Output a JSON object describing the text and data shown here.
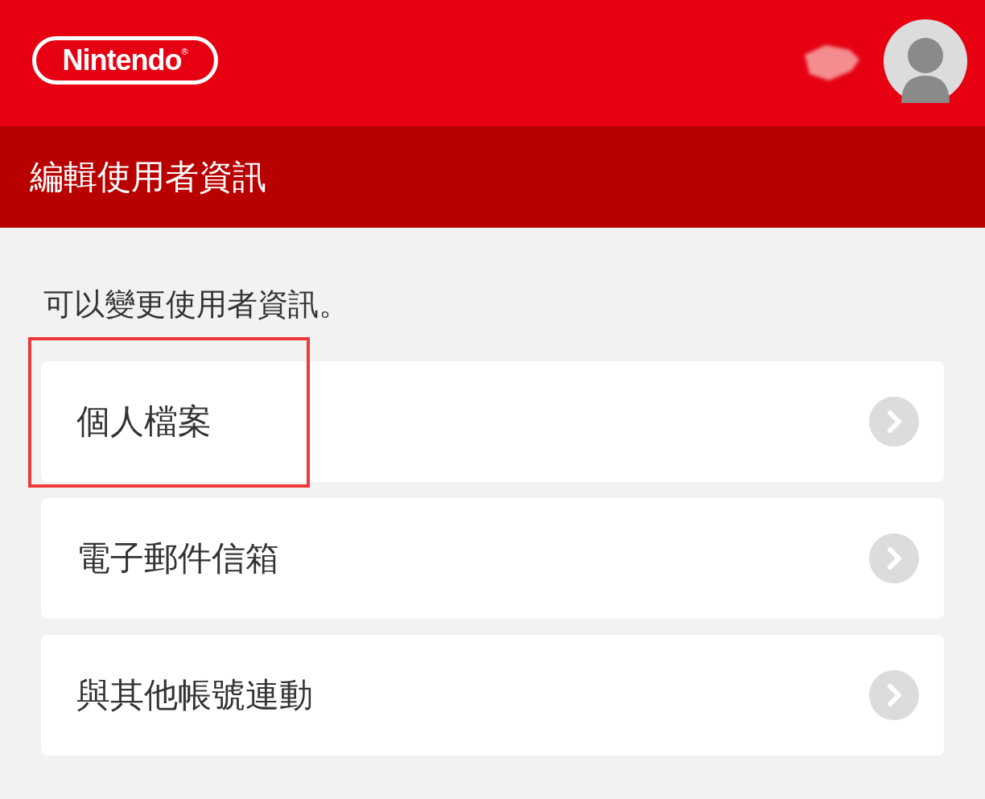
{
  "header": {
    "logo": {
      "text": "Nintendo",
      "mark": "®"
    },
    "redacted_name": true
  },
  "title": "編輯使用者資訊",
  "description": "可以變更使用者資訊。",
  "items": [
    {
      "label": "個人檔案",
      "highlighted": true
    },
    {
      "label": "電子郵件信箱",
      "highlighted": false
    },
    {
      "label": "與其他帳號連動",
      "highlighted": false
    }
  ]
}
